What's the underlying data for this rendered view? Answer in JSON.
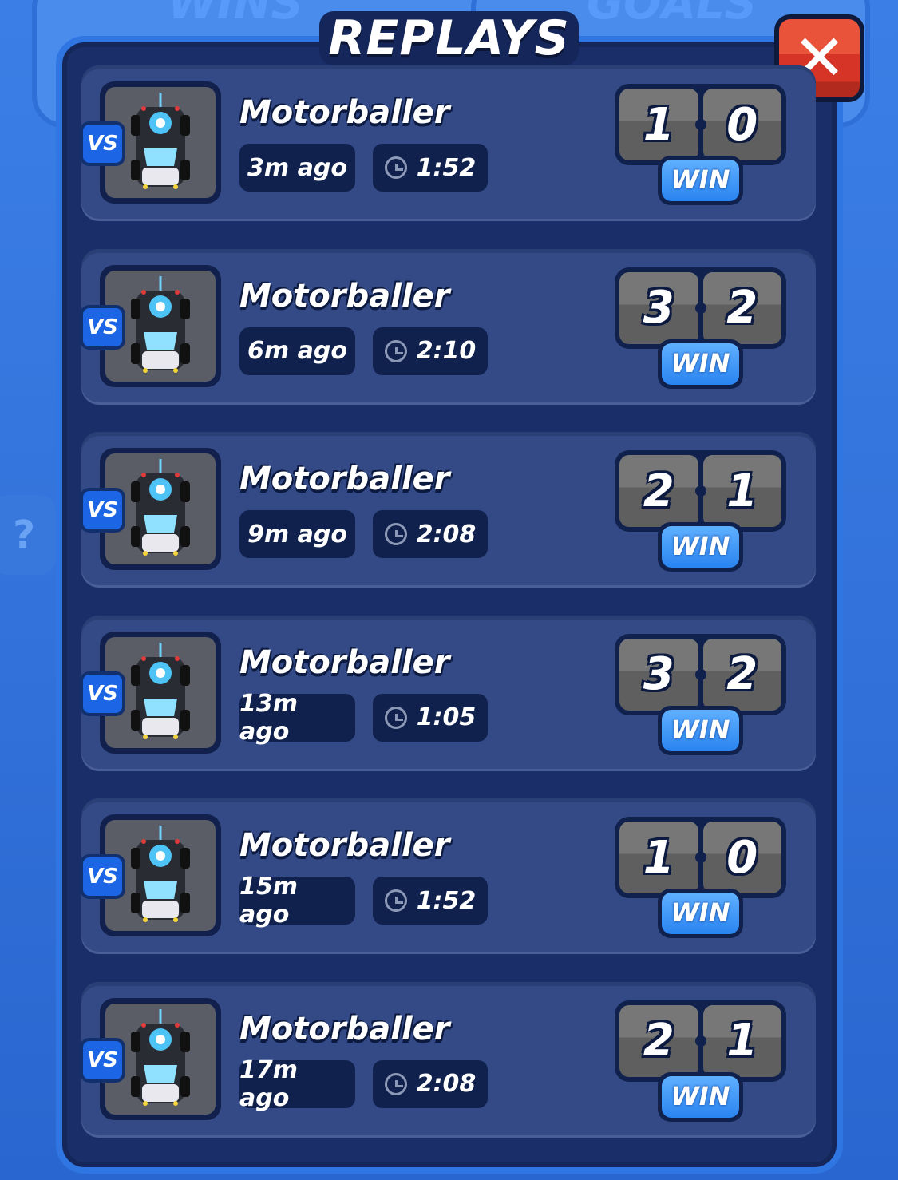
{
  "background": {
    "tabs": [
      "WINS",
      "GOALS"
    ],
    "help_label": "?"
  },
  "dialog": {
    "title": "REPLAYS",
    "close_icon": "close-x-icon",
    "close_label": "✕"
  },
  "colors": {
    "win_badge": "#2a84f0",
    "close_button": "#d63426",
    "vs_badge": "#1c66e6"
  },
  "replays": [
    {
      "opponent": "Motorballer",
      "vs": "VS",
      "ago": "3m ago",
      "duration": "1:52",
      "score_left": "1",
      "score_right": "0",
      "result": "WIN"
    },
    {
      "opponent": "Motorballer",
      "vs": "VS",
      "ago": "6m ago",
      "duration": "2:10",
      "score_left": "3",
      "score_right": "2",
      "result": "WIN"
    },
    {
      "opponent": "Motorballer",
      "vs": "VS",
      "ago": "9m ago",
      "duration": "2:08",
      "score_left": "2",
      "score_right": "1",
      "result": "WIN"
    },
    {
      "opponent": "Motorballer",
      "vs": "VS",
      "ago": "13m ago",
      "duration": "1:05",
      "score_left": "3",
      "score_right": "2",
      "result": "WIN"
    },
    {
      "opponent": "Motorballer",
      "vs": "VS",
      "ago": "15m ago",
      "duration": "1:52",
      "score_left": "1",
      "score_right": "0",
      "result": "WIN"
    },
    {
      "opponent": "Motorballer",
      "vs": "VS",
      "ago": "17m ago",
      "duration": "2:08",
      "score_left": "2",
      "score_right": "1",
      "result": "WIN"
    }
  ]
}
